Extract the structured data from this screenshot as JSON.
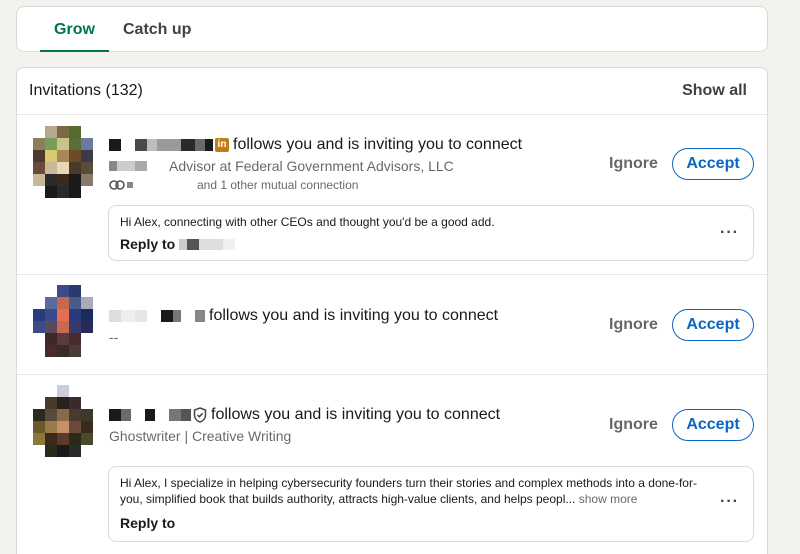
{
  "tabs": {
    "grow": "Grow",
    "catch_up": "Catch up"
  },
  "invitations": {
    "title": "Invitations (132)",
    "show_all": "Show all",
    "items": [
      {
        "action_text": "follows you and is inviting you to connect",
        "headline": "Advisor at Federal Government Advisors, LLC",
        "mutual": "and 1 other mutual connection",
        "message": "Hi Alex, connecting with other CEOs and thought you'd be a good add.",
        "reply_label": "Reply to",
        "ignore": "Ignore",
        "accept": "Accept"
      },
      {
        "action_text": "follows you and is inviting you to connect",
        "headline": "--",
        "ignore": "Ignore",
        "accept": "Accept"
      },
      {
        "action_text": "follows you and is inviting you to connect",
        "headline": "Ghostwriter | Creative Writing",
        "message": "Hi Alex, I specialize in helping cybersecurity founders turn their stories and complex methods into a done-for-you, simplified book that builds authority, attracts high-value clients, and helps peopl...",
        "show_more": "show more",
        "reply_label": "Reply to",
        "ignore": "Ignore",
        "accept": "Accept"
      }
    ]
  },
  "colors": {
    "accent_green": "#01754f",
    "link_blue": "#0a66c2",
    "premium_gold": "#c37d16"
  },
  "icons": [
    "linkedin-premium-badge",
    "verified-shield-icon",
    "mutual-connections-icon",
    "more-options-icon"
  ]
}
